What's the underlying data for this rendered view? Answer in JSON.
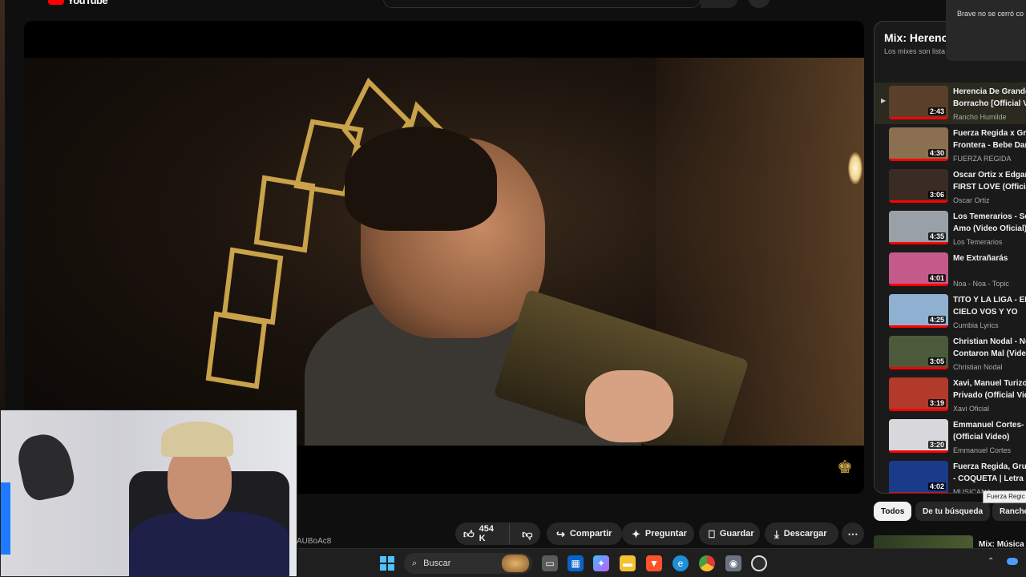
{
  "header": {
    "logo_text": "YouTube"
  },
  "notification": {
    "text": "Brave no se cerró co"
  },
  "video": {
    "id_fragment": "AUBoAc8"
  },
  "actions": {
    "like_count": "454 K",
    "share": "Compartir",
    "ask": "Preguntar",
    "save": "Guardar",
    "download": "Descargar"
  },
  "playlist": {
    "title": "Mix: Herenc",
    "subtitle": "Los mixes son lista",
    "items": [
      {
        "line1": "Herencia De Grande",
        "line2": "Borracho [Official V",
        "channel": "Rancho Humilde",
        "duration": "2:43",
        "color": "#5a3f2a"
      },
      {
        "line1": "Fuerza Regida x Gru",
        "line2": "Frontera - Bebe Dan",
        "channel": "FUERZA REGIDA",
        "duration": "4:30",
        "color": "#8a7050"
      },
      {
        "line1": "Oscar Ortiz x Edgar",
        "line2": "FIRST LOVE (Officia",
        "channel": "Oscar Ortiz",
        "duration": "3:06",
        "color": "#3a2c24"
      },
      {
        "line1": "Los Temerarios - Sé",
        "line2": "Amo (Video Oficial)",
        "channel": "Los Temerarios",
        "duration": "4:35",
        "color": "#9aa0a8"
      },
      {
        "line1": "Me Extrañarás",
        "line2": "",
        "channel": "Noa - Noa - Topic",
        "duration": "4:01",
        "color": "#c45a8a"
      },
      {
        "line1": "TITO Y LA LIGA - EN",
        "line2": "CIELO VOS Y YO",
        "channel": "Cumbia Lyrics",
        "duration": "4:25",
        "color": "#8fb0d0"
      },
      {
        "line1": "Christian Nodal - No",
        "line2": "Contaron Mal (Vide",
        "channel": "Christian Nodal",
        "duration": "3:05",
        "color": "#4a5a3a"
      },
      {
        "line1": "Xavi, Manuel Turizo",
        "line2": "Privado (Official Vid",
        "channel": "Xavi Oficial",
        "duration": "3:19",
        "color": "#b23a2a"
      },
      {
        "line1": "Emmanuel Cortes- ",
        "line2": "(Official Video)",
        "channel": "Emmanuel Cortes",
        "duration": "3:20",
        "color": "#d8d8dc"
      },
      {
        "line1": "Fuerza Regida, Grup",
        "line2": "- COQUETA | Letra",
        "channel": "MUSICANA",
        "duration": "4:02",
        "color": "#1a3a8a"
      }
    ]
  },
  "tooltip": "Fuerza Regic",
  "chips": {
    "all": "Todos",
    "search": "De tu búsqueda",
    "ranch": "Ranche"
  },
  "next": {
    "title": "Mix: Música"
  },
  "taskbar": {
    "search_placeholder": "Buscar"
  },
  "icons": {
    "menu": "menu-icon",
    "like": "thumbs-up-icon",
    "dislike": "thumbs-down-icon",
    "share": "share-icon",
    "ask": "sparkle-icon",
    "save": "bookmark-icon",
    "download": "download-icon",
    "more": "more-icon"
  }
}
